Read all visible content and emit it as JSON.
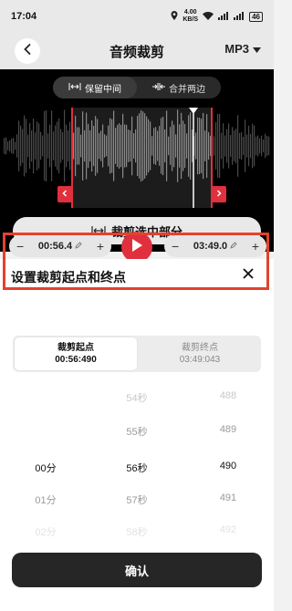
{
  "status": {
    "time": "17:04",
    "speed_value": "4.00",
    "speed_unit": "KB/S",
    "battery": "46"
  },
  "header": {
    "title": "音频裁剪",
    "format": "MP3"
  },
  "editor": {
    "modes": [
      {
        "label": "保留中间",
        "active": true
      },
      {
        "label": "合并两边",
        "active": false
      }
    ],
    "trim_label": "裁剪选中部分"
  },
  "time_controls": {
    "start_value": "00:56.4",
    "end_value": "03:49.0"
  },
  "sheet": {
    "title": "设置裁剪起点和终点",
    "tabs": [
      {
        "label": "裁剪起点",
        "value": "00:56:490",
        "active": true
      },
      {
        "label": "裁剪终点",
        "value": "03:49:043",
        "active": false
      }
    ],
    "picker_rows": [
      {
        "min": "",
        "sec": "54秒",
        "ms": "488"
      },
      {
        "min": "",
        "sec": "55秒",
        "ms": "489"
      },
      {
        "min": "00分",
        "sec": "56秒",
        "ms": "490"
      },
      {
        "min": "01分",
        "sec": "57秒",
        "ms": "491"
      },
      {
        "min": "02分",
        "sec": "58秒",
        "ms": "492"
      }
    ],
    "confirm_label": "确认"
  },
  "colors": {
    "accent": "#e0303d",
    "highlight": "#e5412c",
    "confirm_bg": "#262626"
  }
}
